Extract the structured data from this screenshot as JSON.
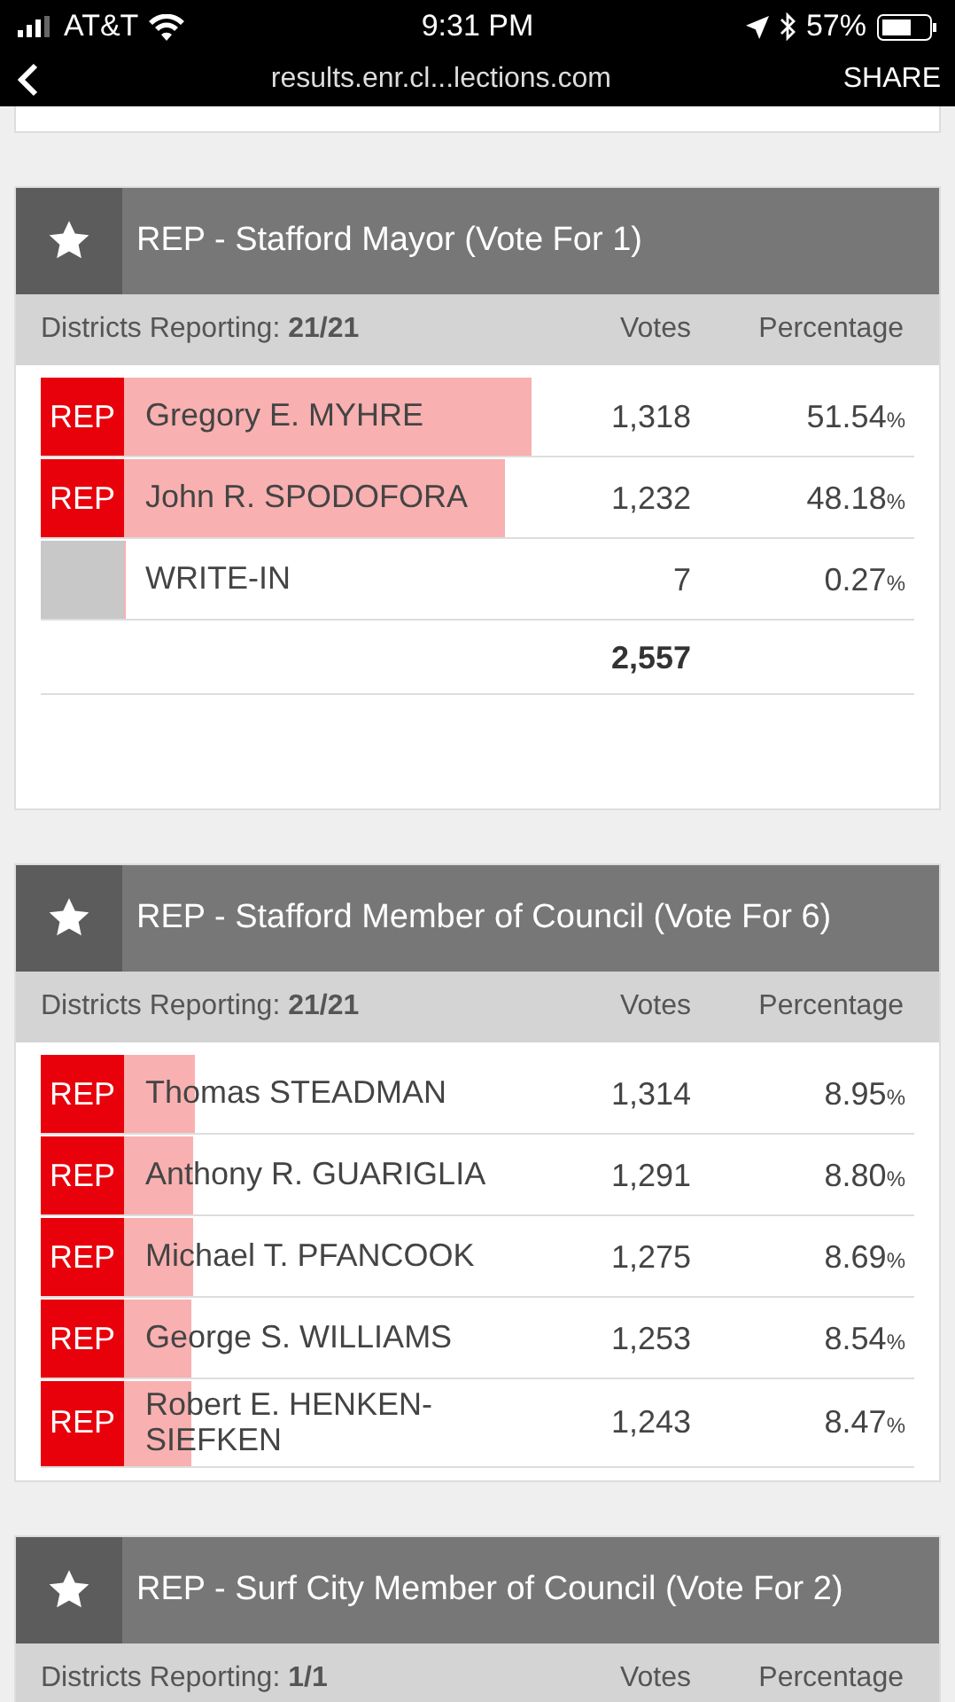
{
  "status_bar": {
    "carrier": "AT&T",
    "time": "9:31 PM",
    "battery": "57%"
  },
  "browser_bar": {
    "url": "results.enr.cl...lections.com",
    "action": "SHARE"
  },
  "contests": [
    {
      "title": "REP - Stafford Mayor (Vote For 1)",
      "reporting_label": "Districts Reporting: ",
      "reporting": "21/21",
      "votes_header": "Votes",
      "percentage_header": "Percentage",
      "total": "2,557",
      "candidates": [
        {
          "party": "REP",
          "color": "#e8000b",
          "name": "Gregory E. MYHRE",
          "votes": "1,318",
          "percent": "51.54",
          "unit": "%",
          "level": 0.5154
        },
        {
          "party": "REP",
          "color": "#e8000b",
          "name": "John R. SPODOFORA",
          "votes": "1,232",
          "percent": "48.18",
          "unit": "%",
          "level": 0.4818
        },
        {
          "color": "#c8c8c8",
          "name": "WRITE-IN",
          "votes": "7",
          "percent": "0.27",
          "unit": "%",
          "level": 0.0027
        }
      ]
    },
    {
      "title": "REP - Stafford Member of Council (Vote For 6)",
      "reporting_label": "Districts Reporting: ",
      "reporting": "21/21",
      "votes_header": "Votes",
      "percentage_header": "Percentage",
      "candidates": [
        {
          "party": "REP",
          "color": "#e8000b",
          "name": "Thomas STEADMAN",
          "votes": "1,314",
          "percent": "8.95",
          "unit": "%",
          "level": 0.0895
        },
        {
          "party": "REP",
          "color": "#e8000b",
          "name": "Anthony R. GUARIGLIA",
          "votes": "1,291",
          "percent": "8.80",
          "unit": "%",
          "level": 0.088
        },
        {
          "party": "REP",
          "color": "#e8000b",
          "name": "Michael T. PFANCOOK",
          "votes": "1,275",
          "percent": "8.69",
          "unit": "%",
          "level": 0.0869
        },
        {
          "party": "REP",
          "color": "#e8000b",
          "name": "George S. WILLIAMS",
          "votes": "1,253",
          "percent": "8.54",
          "unit": "%",
          "level": 0.0854
        },
        {
          "party": "REP",
          "color": "#e8000b",
          "name": "Robert E. HENKEN-SIEFKEN",
          "votes": "1,243",
          "percent": "8.47",
          "unit": "%",
          "level": 0.0847
        }
      ]
    },
    {
      "title": "REP - Surf City Member of Council (Vote For 2)",
      "reporting_label": "Districts Reporting: ",
      "reporting": "1/1",
      "votes_header": "Votes",
      "percentage_header": "Percentage"
    }
  ]
}
